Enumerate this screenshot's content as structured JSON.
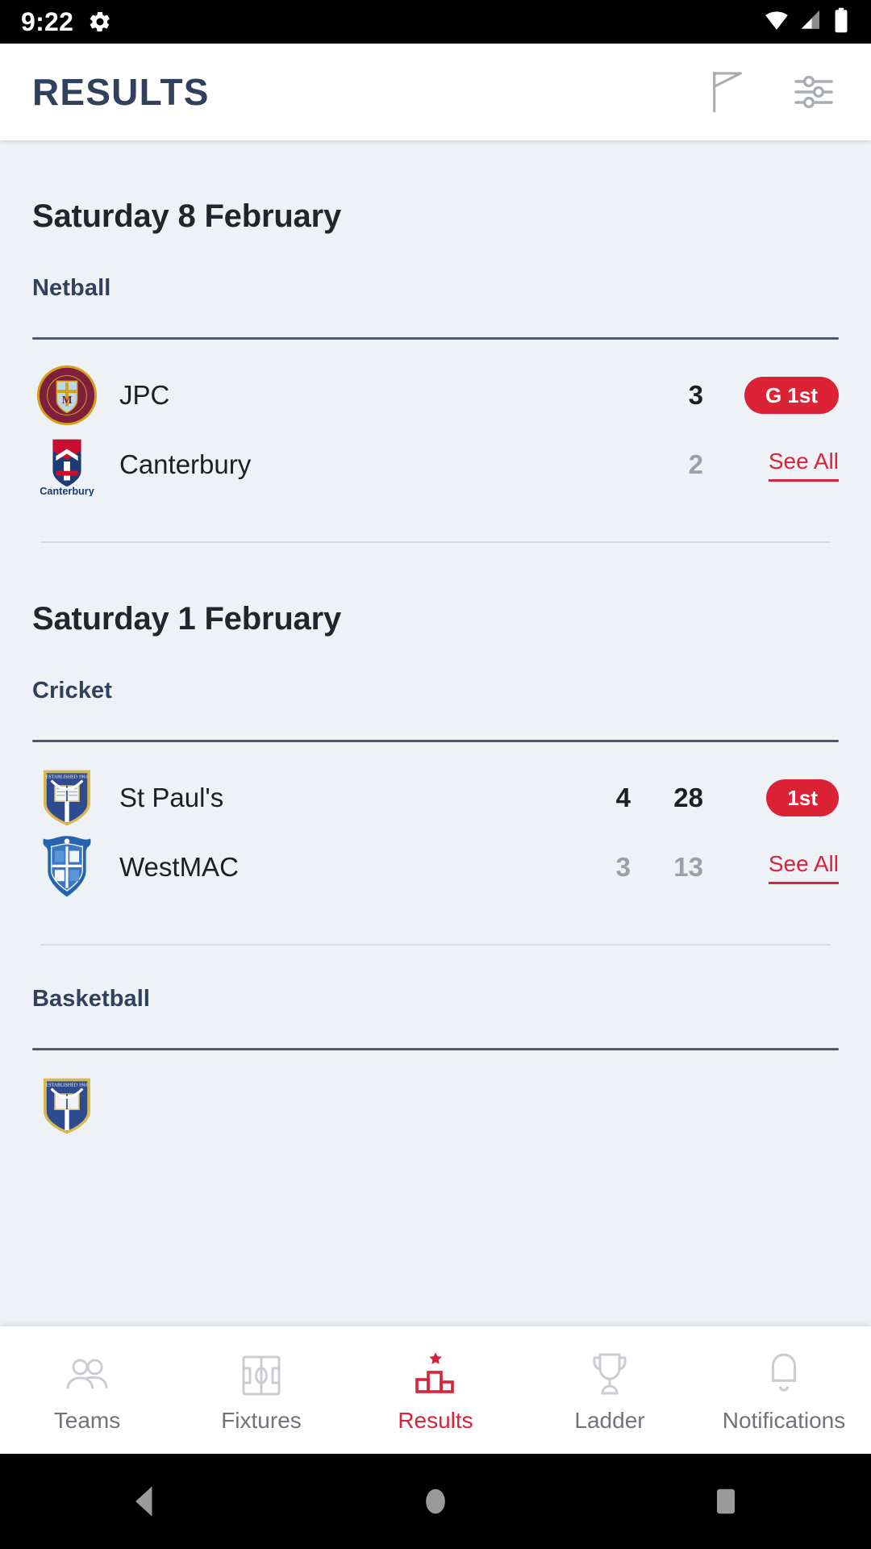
{
  "status_bar": {
    "time": "9:22",
    "icons": [
      "gear-icon",
      "wifi-icon",
      "cellular-signal-icon",
      "battery-icon"
    ]
  },
  "app_bar": {
    "title": "RESULTS",
    "actions": [
      {
        "name": "flag-icon",
        "label": "Flag"
      },
      {
        "name": "filter-sliders-icon",
        "label": "Filter"
      }
    ]
  },
  "sections": [
    {
      "date": "Saturday 8 February",
      "sports": [
        {
          "sport": "Netball",
          "rows": [
            {
              "crest": "jpc-crest",
              "team": "JPC",
              "score": "3",
              "wickets": "",
              "runs": "",
              "badge": "G 1st",
              "link": ""
            },
            {
              "crest": "canterbury-crest",
              "team": "Canterbury",
              "score": "2",
              "wickets": "",
              "runs": "",
              "badge": "",
              "link": "See All"
            }
          ]
        }
      ]
    },
    {
      "date": "Saturday 1 February",
      "sports": [
        {
          "sport": "Cricket",
          "rows": [
            {
              "crest": "stpauls-crest",
              "team": "St Paul's",
              "score": "",
              "wickets": "4",
              "runs": "28",
              "badge": "1st",
              "link": ""
            },
            {
              "crest": "westmac-crest",
              "team": "WestMAC",
              "score": "",
              "wickets": "3",
              "runs": "13",
              "badge": "",
              "link": "See All"
            }
          ]
        },
        {
          "sport": "Basketball",
          "rows": [
            {
              "crest": "stpauls-crest",
              "team": "",
              "score": "",
              "wickets": "",
              "runs": "",
              "badge": "",
              "link": ""
            }
          ]
        }
      ]
    }
  ],
  "bottom_nav": {
    "items": [
      {
        "label": "Teams",
        "icon": "people-icon",
        "active": false
      },
      {
        "label": "Fixtures",
        "icon": "field-icon",
        "active": false
      },
      {
        "label": "Results",
        "icon": "podium-star-icon",
        "active": true
      },
      {
        "label": "Ladder",
        "icon": "trophy-icon",
        "active": false
      },
      {
        "label": "Notifications",
        "icon": "bell-icon",
        "active": false
      }
    ]
  },
  "system_nav": {
    "buttons": [
      {
        "name": "back-button"
      },
      {
        "name": "home-button"
      },
      {
        "name": "recents-button"
      }
    ]
  },
  "colors": {
    "accent_red": "#d9233a",
    "badge_red": "#dc2235",
    "heading_navy": "#31405c",
    "page_bg": "#eef1f5"
  }
}
